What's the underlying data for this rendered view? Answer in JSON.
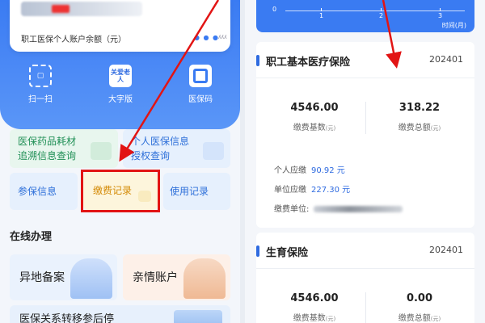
{
  "colors": {
    "accent": "#3a7bf2",
    "highlight": "#e21414",
    "green": "#1f8f55",
    "orange": "#d48a06"
  },
  "left_phone": {
    "account_card": {
      "balance_label": "职工医保个人账户余额（元）"
    },
    "quick_actions": [
      {
        "label": "扫一扫",
        "icon": "scan-icon"
      },
      {
        "label": "大字版",
        "icon": "elder-care-icon",
        "badge": "关爱老人"
      },
      {
        "label": "医保码",
        "icon": "qr-code-icon"
      }
    ],
    "tiles": {
      "drug_trace": {
        "line1": "医保药品耗材",
        "line2": "追溯信息查询"
      },
      "personal_auth": {
        "line1": "个人医保信息",
        "line2": "授权查询"
      },
      "insured_info": "参保信息",
      "payment_record": "缴费记录",
      "usage_record": "使用记录"
    },
    "section_title": "在线办理",
    "services": {
      "remote_filing": "异地备案",
      "family_account": "亲情账户",
      "transfer_suspend": "医保关系转移参后停"
    }
  },
  "right_phone": {
    "chart": {
      "zero": "0",
      "ticks": [
        "1",
        "2",
        "3"
      ],
      "unit": "时间(月)"
    },
    "basic_medical": {
      "title": "职工基本医疗保险",
      "period": "202401",
      "base_value": "4546.00",
      "base_label": "缴费基数",
      "total_value": "318.22",
      "total_label": "缴费总额",
      "unit": "(元)",
      "personal_label": "个人应缴",
      "personal_value": "90.92 元",
      "company_label": "单位应缴",
      "company_value": "227.30 元",
      "payer_label": "缴费单位:"
    },
    "maternity": {
      "title": "生育保险",
      "period": "202401",
      "base_value": "4546.00",
      "base_label": "缴费基数",
      "total_value": "0.00",
      "total_label": "缴费总额",
      "unit": "(元)"
    }
  }
}
